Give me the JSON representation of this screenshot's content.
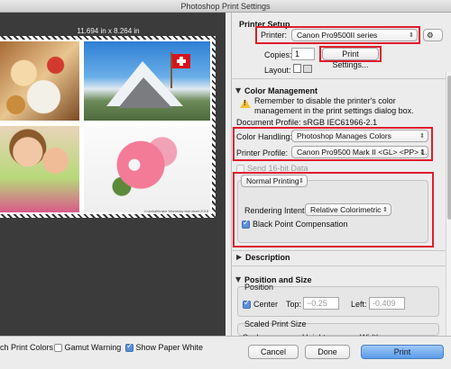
{
  "window": {
    "title": "Photoshop Print Settings"
  },
  "preview": {
    "dimensions": "11.694 in x 8.264 in",
    "credit": "Colorkalibrator Monterey test chart 2018"
  },
  "printer_setup": {
    "header": "Printer Setup",
    "printer_label": "Printer:",
    "printer_value": "Canon Pro9500II series",
    "copies_label": "Copies:",
    "copies_value": "1",
    "print_settings_button": "Print Settings...",
    "layout_label": "Layout:"
  },
  "color_management": {
    "header": "Color Management",
    "warning_text_line1": "Remember to disable the printer's color",
    "warning_text_line2": "management in the print settings dialog box.",
    "document_profile": "Document Profile: sRGB IEC61966-2.1",
    "color_handling_label": "Color Handling:",
    "color_handling_value": "Photoshop Manages Colors",
    "printer_profile_label": "Printer Profile:",
    "printer_profile_value": "Canon Pro9500 Mark II <GL> <PP> 1...",
    "send16_label": "Send 16-bit Data",
    "send16_checked": false,
    "normal_printing_value": "Normal Printing",
    "rendering_intent_label": "Rendering Intent:",
    "rendering_intent_value": "Relative Colorimetric",
    "black_point_label": "Black Point Compensation",
    "black_point_checked": true
  },
  "description": {
    "header": "Description"
  },
  "position_size": {
    "header": "Position and Size",
    "position_label": "Position",
    "center_label": "Center",
    "center_checked": true,
    "top_label": "Top:",
    "top_value": "−0.25",
    "left_label": "Left:",
    "left_value": "-0.409",
    "scaled_print_size_label": "Scaled Print Size",
    "scale_label": "Scale:",
    "height_label": "Height:",
    "width_label": "Width:"
  },
  "bottom": {
    "match_print_colors": "ch Print Colors",
    "match_print_colors_checked": false,
    "gamut_warning": "Gamut Warning",
    "gamut_warning_checked": false,
    "show_paper_white": "Show Paper White",
    "show_paper_white_checked": true,
    "cancel": "Cancel",
    "done": "Done",
    "print": "Print"
  },
  "colors": {
    "highlight": "#e01c2c",
    "accent": "#5a9be9"
  }
}
